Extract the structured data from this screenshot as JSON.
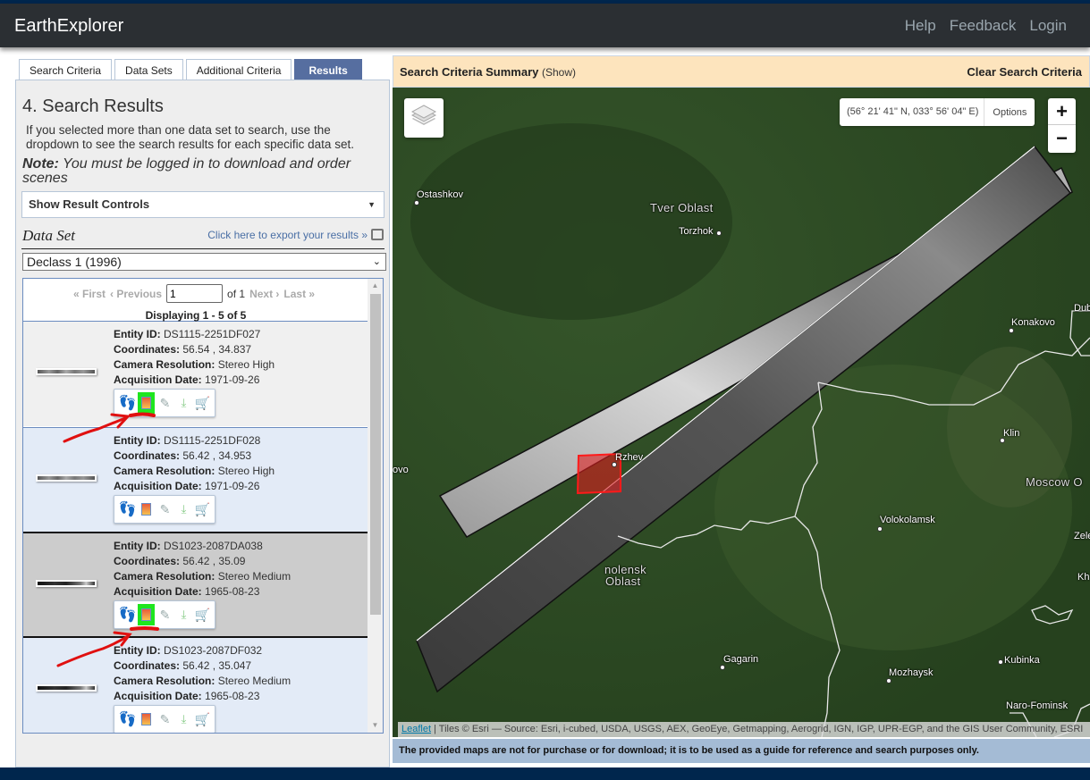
{
  "header": {
    "brand": "EarthExplorer",
    "nav": [
      "Help",
      "Feedback",
      "Login"
    ]
  },
  "tabs": [
    {
      "label": "Search Criteria",
      "active": false
    },
    {
      "label": "Data Sets",
      "active": false
    },
    {
      "label": "Additional Criteria",
      "active": false
    },
    {
      "label": "Results",
      "active": true
    }
  ],
  "results_panel": {
    "title": "4. Search Results",
    "intro": "If you selected more than one data set to search, use the dropdown to see the search results for each specific data set.",
    "note_label": "Note:",
    "note_text": " You must be logged in to download and order scenes",
    "controls_label": "Show Result Controls",
    "dataset_label": "Data Set",
    "export_link": "Click here to export your results »",
    "dataset_selected": "Declass 1 (1996)",
    "pager": {
      "first": "« First",
      "previous": "‹ Previous",
      "page_value": "1",
      "of": "of 1",
      "next": "Next ›",
      "last": "Last »",
      "displaying": "Displaying 1 - 5 of 5"
    },
    "field_labels": {
      "entity": "Entity ID:",
      "coords": "Coordinates:",
      "camera": "Camera Resolution:",
      "date": "Acquisition Date:"
    },
    "rows": [
      {
        "entity_id": "DS1115-2251DF027",
        "coordinates": "56.54 , 34.837",
        "camera_resolution": "Stereo High",
        "acquisition_date": "1971-09-26",
        "browse_highlighted": true
      },
      {
        "entity_id": "DS1115-2251DF028",
        "coordinates": "56.42 , 34.953",
        "camera_resolution": "Stereo High",
        "acquisition_date": "1971-09-26",
        "browse_highlighted": false
      },
      {
        "entity_id": "DS1023-2087DA038",
        "coordinates": "56.42 , 35.09",
        "camera_resolution": "Stereo Medium",
        "acquisition_date": "1965-08-23",
        "browse_highlighted": true
      },
      {
        "entity_id": "DS1023-2087DF032",
        "coordinates": "56.42 , 35.047",
        "camera_resolution": "Stereo Medium",
        "acquisition_date": "1965-08-23",
        "browse_highlighted": false
      }
    ],
    "row_icons": [
      "footprint-icon",
      "browse-overlay-icon",
      "metadata-icon",
      "download-icon",
      "cart-icon"
    ]
  },
  "map": {
    "summary_title": "Search Criteria Summary",
    "summary_show": "(Show)",
    "clear_label": "Clear Search Criteria",
    "cursor_coords": "(56° 21' 41\" N, 033° 56' 04\" E)",
    "options_label": "Options",
    "zoom_in": "+",
    "zoom_out": "−",
    "attribution_link": "Leaflet",
    "attribution_text": " | Tiles © Esri — Source: Esri, i-cubed, USDA, USGS, AEX, GeoEye, Getmapping, Aerogrid, IGN, IGP, UPR-EGP, and the GIS User Community, ESRI",
    "disclaimer": "The provided maps are not for purchase or for download; it is to be used as a guide for reference and search purposes only.",
    "labels": {
      "ostashkov": "Ostashkov",
      "tver": "Tver Oblast",
      "torzhok": "Torzhok",
      "konakovo": "Konakovo",
      "dubna": "Dub",
      "klin": "Klin",
      "moscow": "Moscow O",
      "zelenograd": "Zelenog",
      "kh": "Kh",
      "volokolamsk": "Volokolamsk",
      "rzhev": "Rzhev",
      "smolensk1": "nolensk",
      "smolensk2": "Oblast",
      "gagarin": "Gagarin",
      "mozhaysk": "Mozhaysk",
      "kubinka": "Kubinka",
      "naro": "Naro-Fominsk",
      "ovo": "ovo"
    }
  }
}
